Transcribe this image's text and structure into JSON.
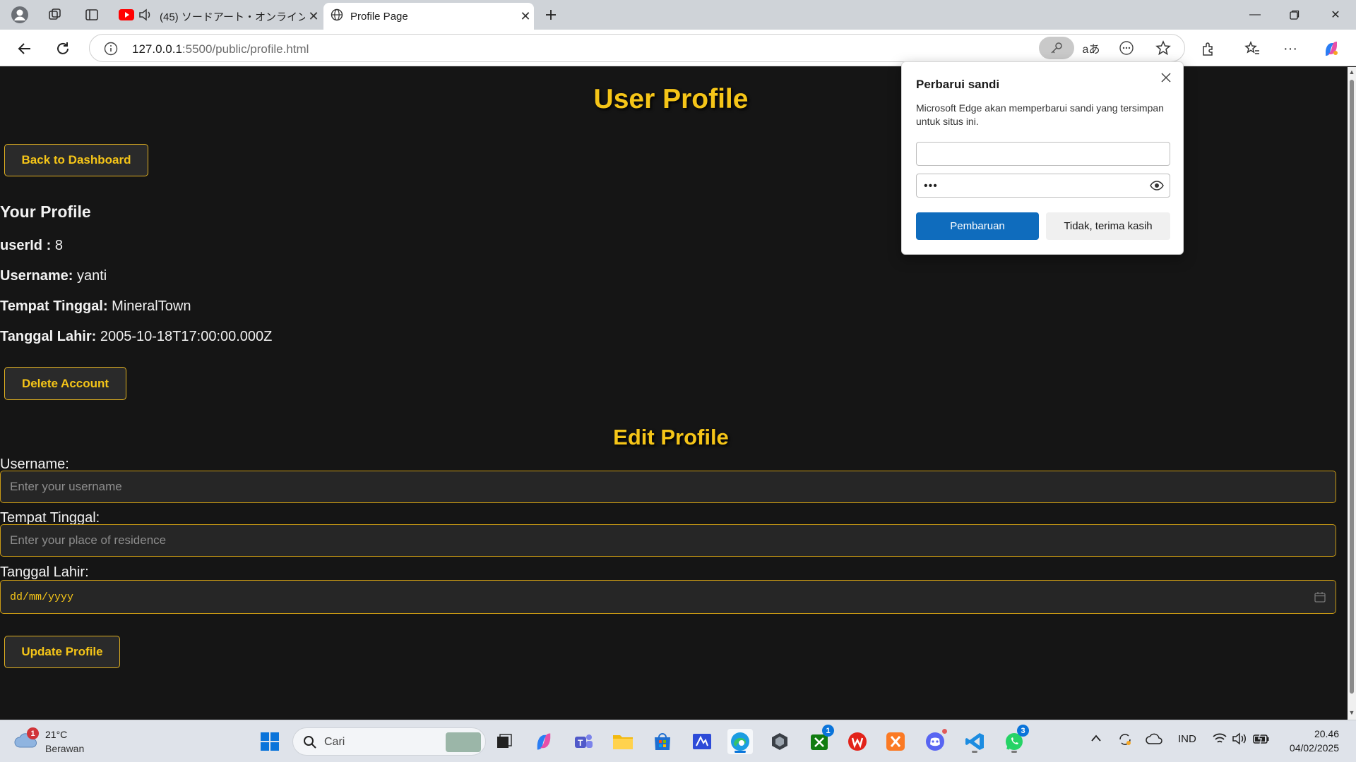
{
  "browser": {
    "tabs": [
      {
        "title": "(45) ソードアート・オンライン シリーズ",
        "active": false
      },
      {
        "title": "Profile Page",
        "active": true
      }
    ],
    "url_host": "127.0.0.1",
    "url_path": ":5500/public/profile.html"
  },
  "page": {
    "title": "User Profile",
    "back_button": "Back to Dashboard",
    "profile_heading": "Your Profile",
    "fields": [
      {
        "label": "userId :",
        "value": "8"
      },
      {
        "label": "Username:",
        "value": "yanti"
      },
      {
        "label": "Tempat Tinggal:",
        "value": "MineralTown"
      },
      {
        "label": "Tanggal Lahir:",
        "value": "2005-10-18T17:00:00.000Z"
      }
    ],
    "delete_button": "Delete Account",
    "edit_heading": "Edit Profile",
    "form": {
      "username_label": "Username:",
      "username_placeholder": "Enter your username",
      "residence_label": "Tempat Tinggal:",
      "residence_placeholder": "Enter your place of residence",
      "birth_label": "Tanggal Lahir:",
      "birth_placeholder": "dd/mm/yyyy",
      "submit_button": "Update Profile"
    }
  },
  "password_popup": {
    "title": "Perbarui sandi",
    "description": "Microsoft Edge akan memperbarui sandi yang tersimpan untuk situs ini.",
    "username_value": "",
    "password_mask": "•••",
    "primary_button": "Pembaruan",
    "secondary_button": "Tidak, terima kasih"
  },
  "taskbar": {
    "weather_temp": "21°C",
    "weather_condition": "Berawan",
    "weather_badge": "1",
    "search_placeholder": "Cari",
    "xbox_badge": "1",
    "whatsapp_badge": "3",
    "language": "IND",
    "time": "20.46",
    "date": "04/02/2025"
  },
  "colors": {
    "accent_gold": "#f5c518",
    "page_background": "#151515",
    "edge_blue": "#0f6cbd"
  }
}
